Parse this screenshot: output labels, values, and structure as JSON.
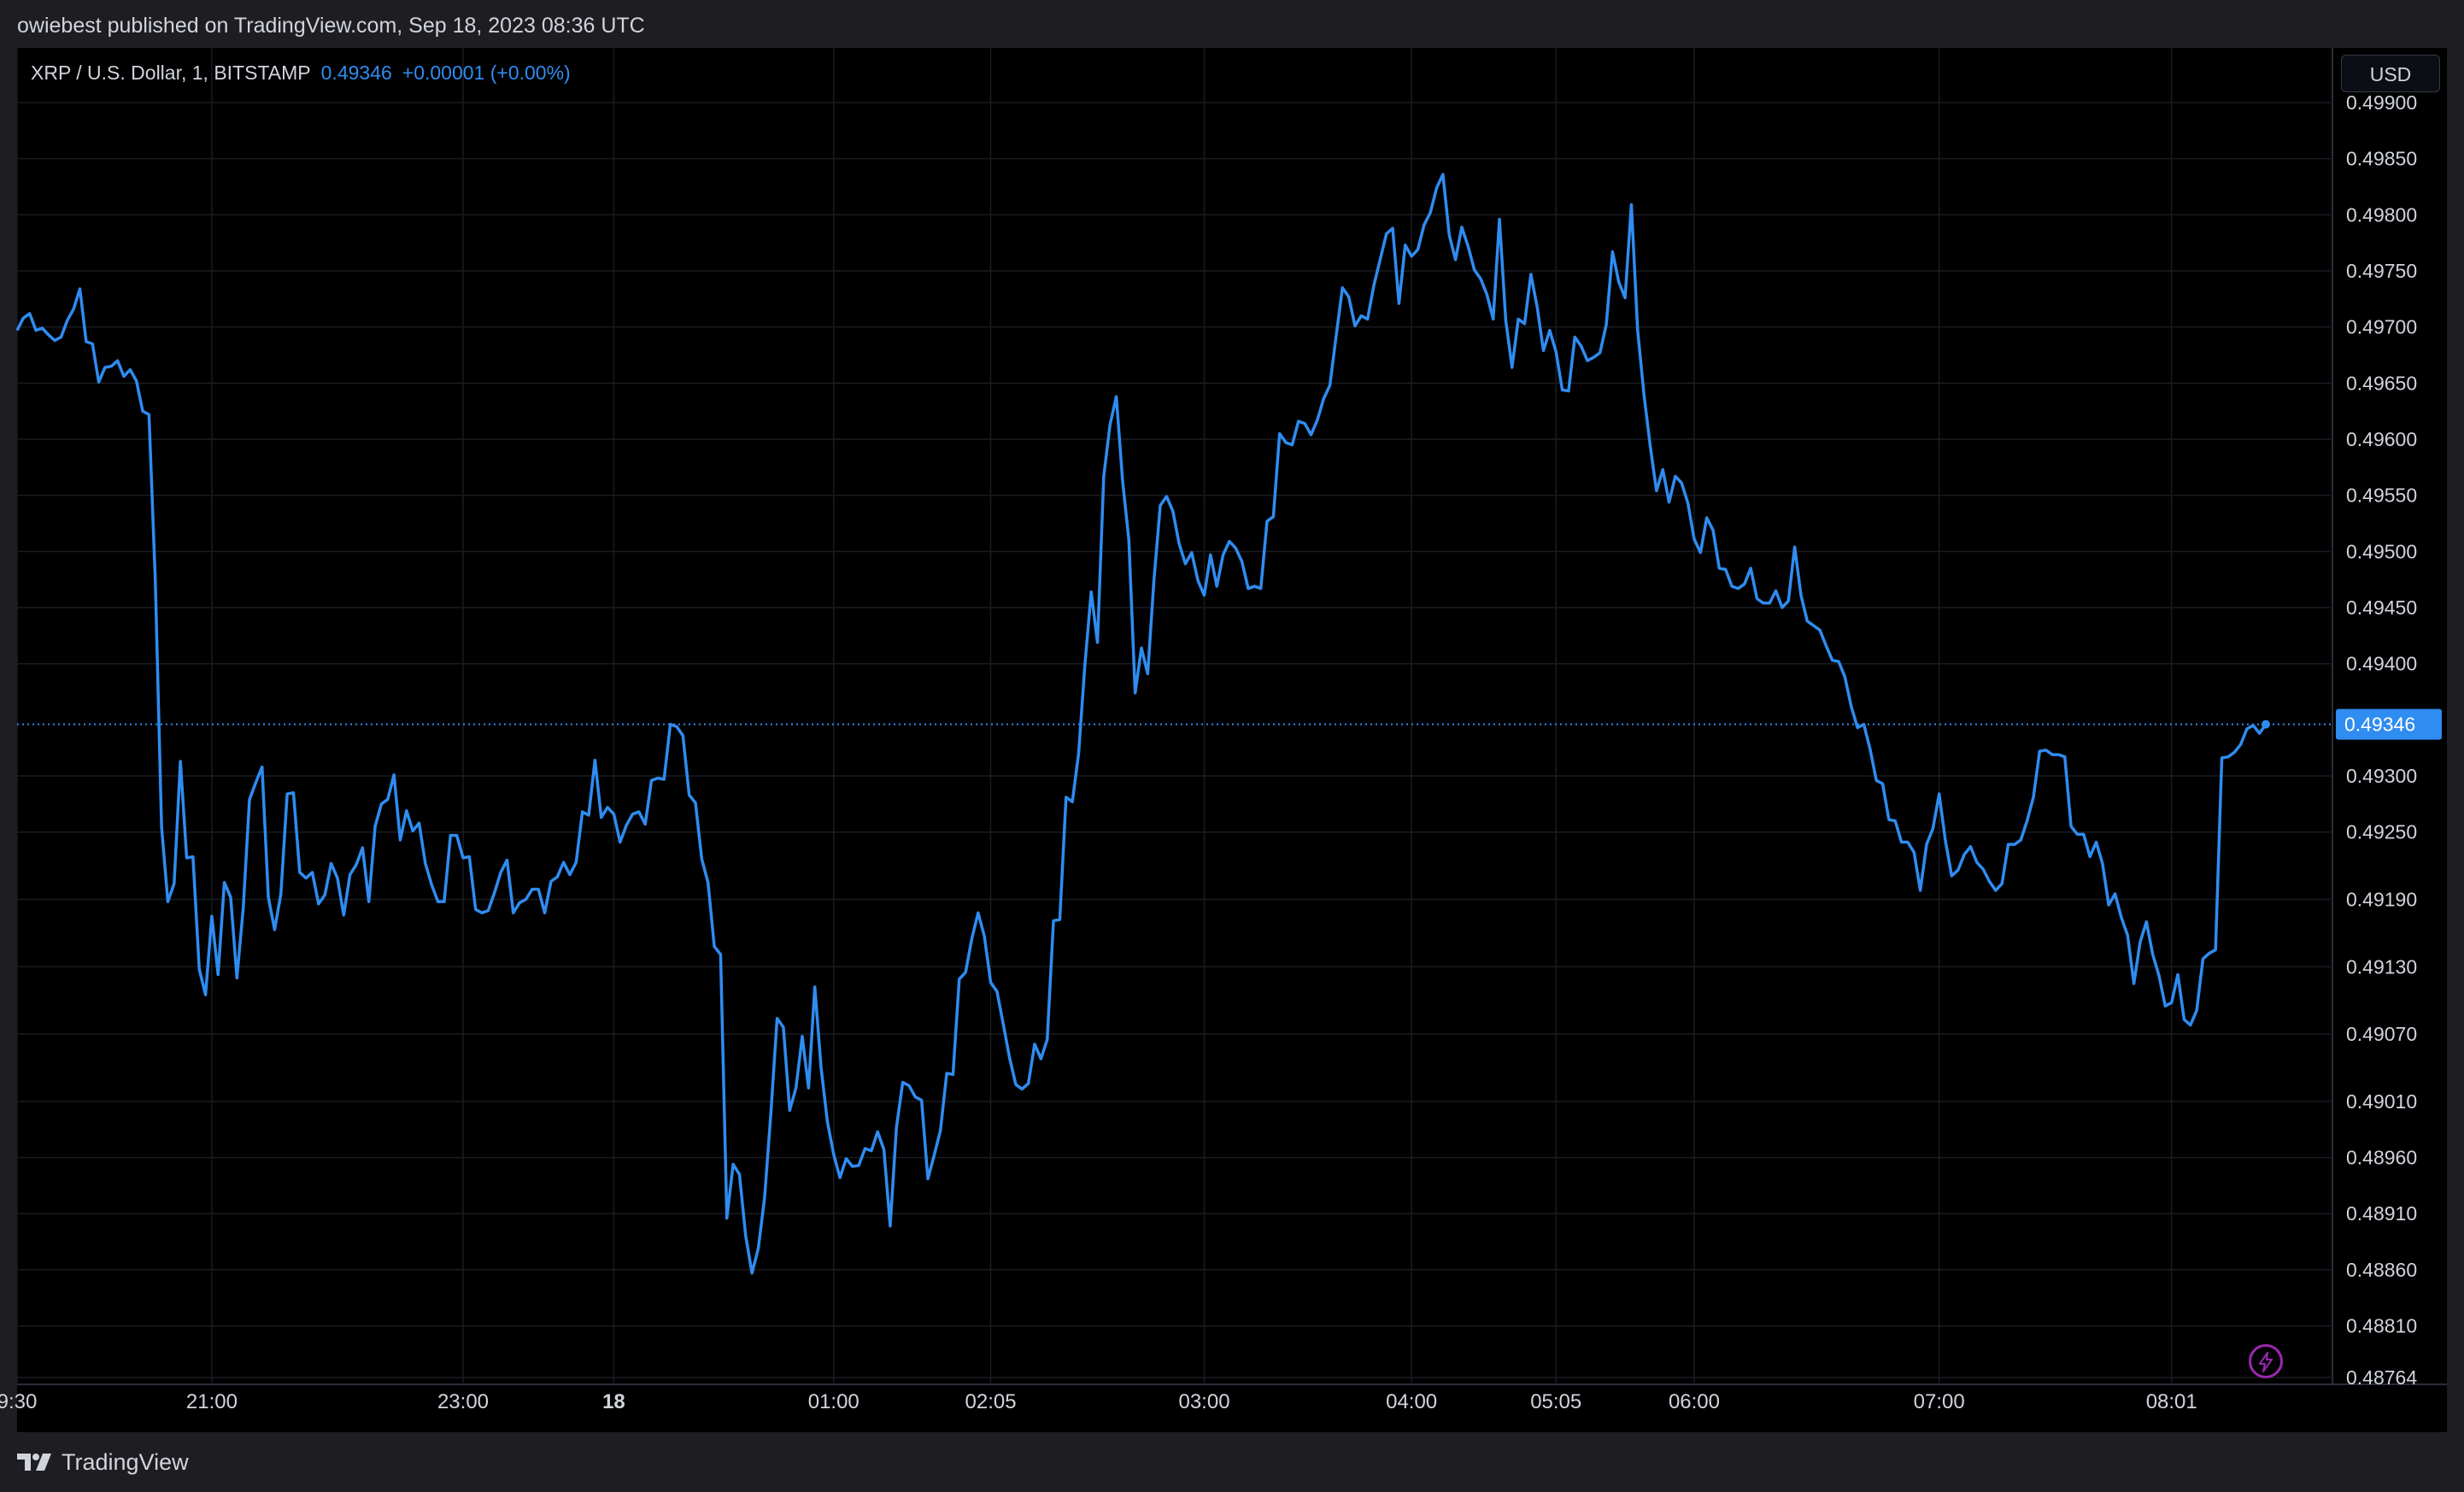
{
  "header": {
    "published_text": "owiebest published on TradingView.com, Sep 18, 2023 08:36 UTC"
  },
  "legend": {
    "symbol": "XRP / U.S. Dollar, 1, BITSTAMP",
    "last_price": "0.49346",
    "change": "+0.00001 (+0.00%)"
  },
  "price_scale": {
    "currency_label": "USD",
    "last_price_label": "0.49346"
  },
  "footer": {
    "brand": "TradingView"
  },
  "colors": {
    "line": "#2f8cf0",
    "background": "#000000",
    "grid": "#1a1c22",
    "axis_text": "#d1d4dc",
    "accent_badge": "#2f8cf0"
  },
  "icons": [
    "tradingview-logo-icon",
    "lightning-icon"
  ],
  "chart_data": {
    "type": "line",
    "title": "XRP / U.S. Dollar, 1, BITSTAMP",
    "xlabel": "",
    "ylabel": "",
    "ylim": [
      0.48764,
      0.49925
    ],
    "grid": true,
    "y_ticks": [
      "0.49900",
      "0.49850",
      "0.49800",
      "0.49750",
      "0.49700",
      "0.49650",
      "0.49600",
      "0.49550",
      "0.49500",
      "0.49450",
      "0.49400",
      "0.49300",
      "0.49250",
      "0.49190",
      "0.49130",
      "0.49070",
      "0.49010",
      "0.48960",
      "0.48910",
      "0.48860",
      "0.48810",
      "0.48764"
    ],
    "x_ticks": [
      {
        "label": "9:30",
        "t": 0,
        "bold": false
      },
      {
        "label": "21:00",
        "t": 31,
        "bold": false
      },
      {
        "label": "23:00",
        "t": 71,
        "bold": false
      },
      {
        "label": "18",
        "t": 95,
        "bold": true
      },
      {
        "label": "01:00",
        "t": 130,
        "bold": false
      },
      {
        "label": "02:05",
        "t": 155,
        "bold": false
      },
      {
        "label": "03:00",
        "t": 189,
        "bold": false
      },
      {
        "label": "04:00",
        "t": 222,
        "bold": false
      },
      {
        "label": "05:05",
        "t": 245,
        "bold": false
      },
      {
        "label": "06:00",
        "t": 267,
        "bold": false
      },
      {
        "label": "07:00",
        "t": 306,
        "bold": false
      },
      {
        "label": "08:01",
        "t": 343,
        "bold": false
      }
    ],
    "series": [
      {
        "values": [
          0.49697,
          0.49708,
          0.49712,
          0.49697,
          0.49699,
          0.49693,
          0.49688,
          0.49691,
          0.49706,
          0.49716,
          0.49734,
          0.49687,
          0.49685,
          0.49651,
          0.49664,
          0.49665,
          0.4967,
          0.49656,
          0.49662,
          0.49652,
          0.49625,
          0.49622,
          0.49475,
          0.49255,
          0.49188,
          0.49204,
          0.49313,
          0.49227,
          0.49228,
          0.49128,
          0.49105,
          0.49175,
          0.49123,
          0.49205,
          0.49192,
          0.4912,
          0.49182,
          0.49279,
          0.49294,
          0.49308,
          0.49192,
          0.49163,
          0.49195,
          0.49284,
          0.49285,
          0.49214,
          0.49209,
          0.49214,
          0.49186,
          0.49194,
          0.49222,
          0.49209,
          0.49176,
          0.49212,
          0.49221,
          0.49236,
          0.49188,
          0.49255,
          0.49275,
          0.49279,
          0.49301,
          0.49243,
          0.49269,
          0.49251,
          0.49258,
          0.49222,
          0.49203,
          0.49188,
          0.49188,
          0.49247,
          0.49247,
          0.49227,
          0.49228,
          0.49181,
          0.49178,
          0.4918,
          0.49196,
          0.49214,
          0.49225,
          0.49178,
          0.49187,
          0.4919,
          0.49199,
          0.49199,
          0.49178,
          0.49206,
          0.4921,
          0.49223,
          0.49212,
          0.49223,
          0.49268,
          0.49265,
          0.49314,
          0.49263,
          0.49272,
          0.49266,
          0.49241,
          0.49256,
          0.49266,
          0.49268,
          0.49257,
          0.49296,
          0.49298,
          0.49297,
          0.49346,
          0.49344,
          0.49336,
          0.49283,
          0.49276,
          0.49226,
          0.49205,
          0.49148,
          0.49141,
          0.48906,
          0.48954,
          0.48945,
          0.4889,
          0.48857,
          0.48879,
          0.48924,
          0.48999,
          0.49084,
          0.49076,
          0.49002,
          0.49022,
          0.49068,
          0.49022,
          0.49112,
          0.4904,
          0.48992,
          0.48963,
          0.48942,
          0.48959,
          0.48952,
          0.48953,
          0.48968,
          0.48966,
          0.48983,
          0.48967,
          0.48899,
          0.48987,
          0.49027,
          0.49024,
          0.49014,
          0.49011,
          0.48941,
          0.48962,
          0.48984,
          0.49035,
          0.49034,
          0.49119,
          0.49125,
          0.49155,
          0.49178,
          0.49157,
          0.49116,
          0.49108,
          0.49079,
          0.49049,
          0.49025,
          0.49021,
          0.49026,
          0.49061,
          0.49048,
          0.49065,
          0.49171,
          0.49172,
          0.49281,
          0.49277,
          0.4932,
          0.49399,
          0.49464,
          0.49419,
          0.49567,
          0.49613,
          0.49638,
          0.49563,
          0.4951,
          0.49374,
          0.49414,
          0.49391,
          0.49475,
          0.49541,
          0.49549,
          0.49536,
          0.49507,
          0.49489,
          0.49499,
          0.49474,
          0.49461,
          0.49497,
          0.49469,
          0.49497,
          0.49509,
          0.49503,
          0.49491,
          0.49467,
          0.49469,
          0.49467,
          0.49527,
          0.49531,
          0.49605,
          0.49597,
          0.49595,
          0.49616,
          0.49614,
          0.49604,
          0.49617,
          0.49636,
          0.49648,
          0.49692,
          0.49735,
          0.49727,
          0.49701,
          0.4971,
          0.49707,
          0.49737,
          0.4976,
          0.49783,
          0.49788,
          0.49721,
          0.49773,
          0.49763,
          0.49769,
          0.49791,
          0.49802,
          0.49824,
          0.49836,
          0.49782,
          0.4976,
          0.49789,
          0.49772,
          0.49751,
          0.49743,
          0.49729,
          0.49707,
          0.49796,
          0.49706,
          0.49664,
          0.49707,
          0.49703,
          0.49747,
          0.49718,
          0.49679,
          0.49697,
          0.49678,
          0.49644,
          0.49643,
          0.49691,
          0.49683,
          0.4967,
          0.49673,
          0.49677,
          0.49702,
          0.49767,
          0.4974,
          0.49726,
          0.49809,
          0.49697,
          0.4964,
          0.49594,
          0.49554,
          0.49573,
          0.49544,
          0.49567,
          0.49561,
          0.49543,
          0.49511,
          0.49499,
          0.4953,
          0.49519,
          0.49485,
          0.49484,
          0.49469,
          0.49467,
          0.49471,
          0.49485,
          0.49458,
          0.49454,
          0.49454,
          0.49465,
          0.4945,
          0.49456,
          0.49504,
          0.49461,
          0.49438,
          0.49434,
          0.4943,
          0.49416,
          0.49403,
          0.49402,
          0.49388,
          0.49362,
          0.49343,
          0.49346,
          0.49324,
          0.49296,
          0.49293,
          0.49261,
          0.4926,
          0.49241,
          0.49241,
          0.49232,
          0.49198,
          0.49239,
          0.49253,
          0.49284,
          0.49242,
          0.49211,
          0.49216,
          0.4923,
          0.49237,
          0.49223,
          0.49217,
          0.49206,
          0.49198,
          0.49204,
          0.49239,
          0.49239,
          0.49243,
          0.4926,
          0.49281,
          0.49322,
          0.49323,
          0.49319,
          0.49319,
          0.49317,
          0.49255,
          0.49248,
          0.49248,
          0.49228,
          0.49241,
          0.49222,
          0.49185,
          0.49195,
          0.49174,
          0.49158,
          0.49115,
          0.49152,
          0.4917,
          0.49141,
          0.49122,
          0.49095,
          0.49098,
          0.49123,
          0.49083,
          0.49078,
          0.49091,
          0.49137,
          0.49142,
          0.49145,
          0.49316,
          0.49317,
          0.49321,
          0.49328,
          0.49342,
          0.49345,
          0.49338,
          0.49346
        ]
      }
    ]
  }
}
